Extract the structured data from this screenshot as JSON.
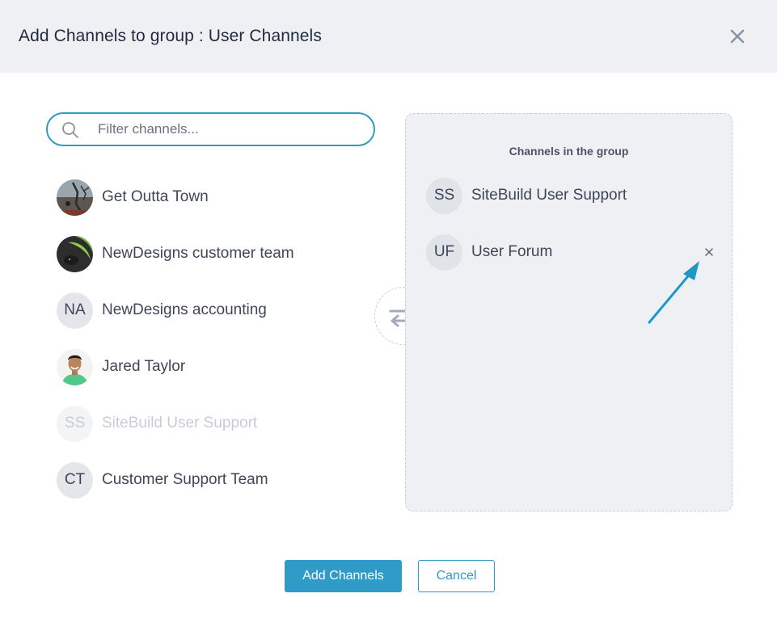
{
  "dialog": {
    "title": "Add Channels to group : User Channels",
    "close_icon": "close-icon"
  },
  "search": {
    "placeholder": "Filter channels...",
    "value": "",
    "icon": "search-icon"
  },
  "channels": [
    {
      "label": "Get Outta Town",
      "avatar": "photo",
      "disabled": false
    },
    {
      "label": "NewDesigns customer team",
      "avatar": "photo",
      "disabled": false
    },
    {
      "label": "NewDesigns accounting",
      "avatar": "NA",
      "disabled": false
    },
    {
      "label": "Jared Taylor",
      "avatar": "photo",
      "disabled": false
    },
    {
      "label": "SiteBuild User Support",
      "avatar": "SS",
      "disabled": true
    },
    {
      "label": "Customer Support Team",
      "avatar": "CT",
      "disabled": false
    }
  ],
  "swap_icon": "swap-arrows-icon",
  "group": {
    "title": "Channels in the group",
    "items": [
      {
        "label": "SiteBuild User Support",
        "initials": "SS"
      },
      {
        "label": "User Forum",
        "initials": "UF",
        "remove_icon": "remove-icon"
      }
    ]
  },
  "buttons": {
    "add": "Add Channels",
    "cancel": "Cancel"
  },
  "colors": {
    "accent": "#2f9bc6",
    "header_bg": "#eef0f3",
    "panel_bg": "#eef0f3",
    "annotation_arrow": "#1e98c4"
  }
}
